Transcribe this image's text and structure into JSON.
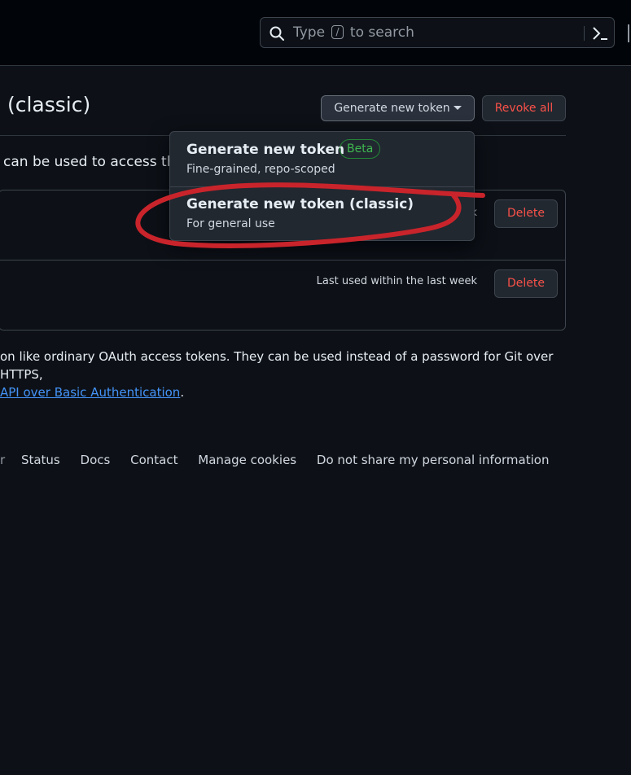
{
  "header": {
    "search": {
      "text_before": "Type",
      "shortcut_key": "/",
      "text_after": "to search"
    },
    "icons": [
      "search-icon",
      "command-palette-icon"
    ]
  },
  "page": {
    "title": "s (classic)",
    "generate_button_label": "Generate new token",
    "revoke_all_label": "Revoke all",
    "intro_text": "can be used to access the"
  },
  "tokens": [
    {
      "last_used": "k",
      "delete_label": "Delete"
    },
    {
      "last_used": "Last used within the last week",
      "delete_label": "Delete"
    }
  ],
  "footnote": {
    "line1": "on like ordinary OAuth access tokens. They can be used instead of a password for Git over HTTPS,",
    "link_text": "API over Basic Authentication",
    "trailing": "."
  },
  "footer": {
    "stub": "r",
    "links": [
      "Status",
      "Docs",
      "Contact",
      "Manage cookies",
      "Do not share my personal information"
    ]
  },
  "dropdown": {
    "items": [
      {
        "title": "Generate new token",
        "badge": "Beta",
        "subtitle": "Fine-grained, repo-scoped"
      },
      {
        "title": "Generate new token (classic)",
        "subtitle": "For general use"
      }
    ]
  },
  "colors": {
    "background": "#0d1117",
    "danger": "#f85149",
    "link": "#4493f8",
    "annotation": "#c9242b",
    "beta_badge": "#3fb950"
  }
}
